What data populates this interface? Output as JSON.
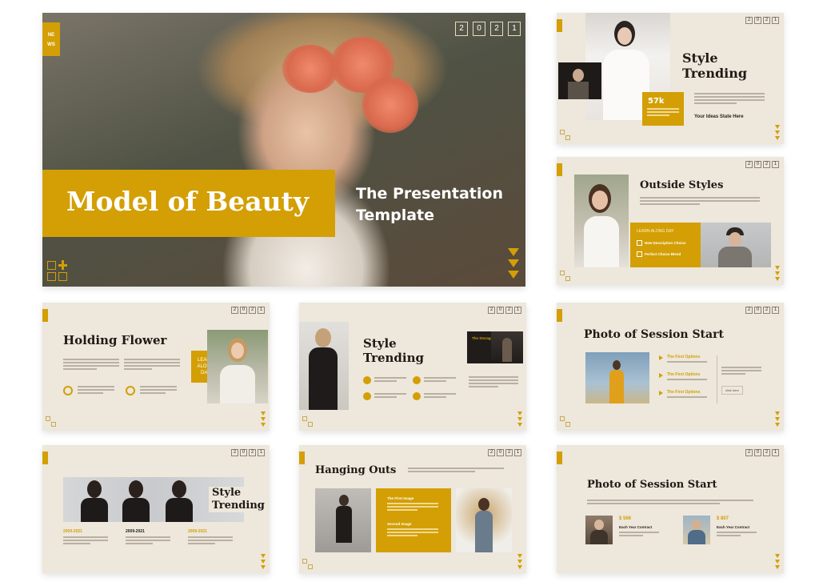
{
  "colors": {
    "accent": "#d39f05",
    "slide_bg": "#ede7dc",
    "text": "#1e1a14"
  },
  "year_digits": [
    "2",
    "0",
    "2",
    "1"
  ],
  "hero": {
    "tag_line1": "NE",
    "tag_line2": "WS",
    "title": "Model of Beauty",
    "subtitle": "The Presentation Template"
  },
  "slide_style_trending_1": {
    "title_line1": "Style",
    "title_line2": "Trending",
    "stat_value": "57k",
    "footer": "Your Ideas State Here"
  },
  "slide_outside_styles": {
    "title": "Outside Styles",
    "box_heading": "LEARN ALONG DAY",
    "item1": "New Description Choice",
    "item2": "Perfect Choice Blend"
  },
  "slide_holding_flower": {
    "title": "Holding Flower",
    "box_line1": "LEARN",
    "box_line2": "ALONG",
    "box_line3": "DAY"
  },
  "slide_style_trending_2": {
    "title_line1": "Style",
    "title_line2": "Trending",
    "label": "The Storage"
  },
  "slide_photo_session_1": {
    "title": "Photo of Session Start",
    "opt1": "The First Options",
    "opt2": "The First Options",
    "opt3": "The First Options",
    "btn": "click here"
  },
  "slide_style_trending_3": {
    "title_line1": "Style",
    "title_line2": "Trending",
    "years": [
      "2009-2021",
      "2009-2021",
      "2009-2021"
    ]
  },
  "slide_hanging_outs": {
    "title": "Hanging Outs",
    "h1": "The First Image",
    "h2": "Second Image"
  },
  "slide_photo_session_2": {
    "title": "Photo of Session Start",
    "price1": "$ 566",
    "price2": "$ 807",
    "contract1": "Each Year Contract",
    "contract2": "Each Year Contract"
  }
}
